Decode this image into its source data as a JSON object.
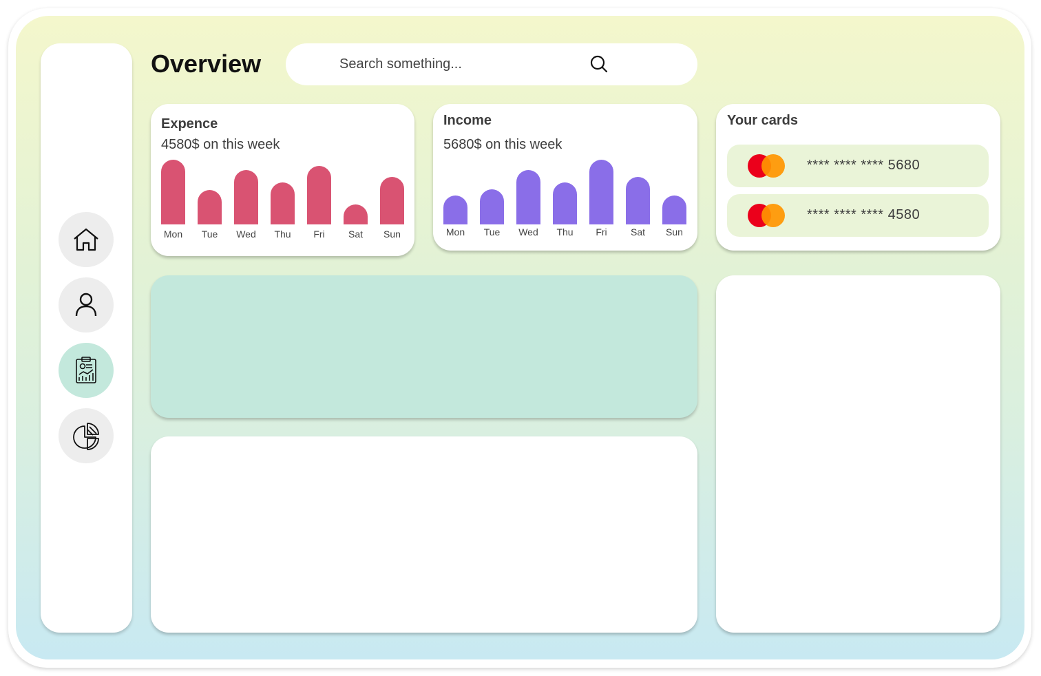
{
  "header": {
    "title": "Overview"
  },
  "search": {
    "placeholder": "Search something..."
  },
  "sidebar": {
    "items": [
      {
        "icon": "home-icon",
        "active": false
      },
      {
        "icon": "user-icon",
        "active": false
      },
      {
        "icon": "report-icon",
        "active": true
      },
      {
        "icon": "pie-chart-icon",
        "active": false
      }
    ]
  },
  "expense": {
    "title": "Expence",
    "subtitle": "4580$ on this week",
    "color": "#d95372"
  },
  "income": {
    "title": "Income",
    "subtitle": "5680$ on this week",
    "color": "#8a6ee8"
  },
  "cards": {
    "title": "Your cards",
    "items": [
      {
        "number": "**** **** **** 5680",
        "brand_icon": "mastercard-icon"
      },
      {
        "number": "**** **** **** 4580",
        "brand_icon": "mastercard-icon"
      }
    ]
  },
  "colors": {
    "accent_teal": "#c3e8dc",
    "nav_inactive": "#ededed",
    "card_bg": "#eaf4d8"
  },
  "chart_data": [
    {
      "type": "bar",
      "categories": [
        "Mon",
        "Tue",
        "Wed",
        "Thu",
        "Fri",
        "Sat",
        "Sun"
      ],
      "values": [
        97,
        52,
        81,
        63,
        88,
        30,
        71
      ],
      "title": "Expence",
      "xlabel": "",
      "ylabel": "",
      "ylim": [
        0,
        100
      ]
    },
    {
      "type": "bar",
      "categories": [
        "Mon",
        "Tue",
        "Wed",
        "Thu",
        "Fri",
        "Sat",
        "Sun"
      ],
      "values": [
        43,
        53,
        81,
        63,
        97,
        71,
        43
      ],
      "title": "Income",
      "xlabel": "",
      "ylabel": "",
      "ylim": [
        0,
        100
      ]
    }
  ]
}
